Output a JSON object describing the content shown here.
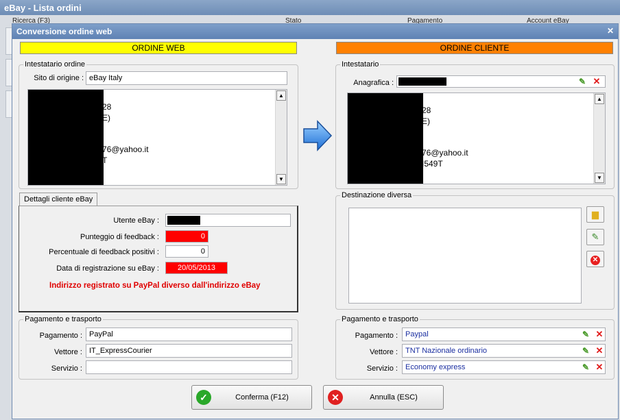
{
  "background": {
    "title": "eBay - Lista ordini",
    "headers": [
      "Ricerca (F3)",
      "Stato",
      "Pagamento",
      "Account eBay"
    ]
  },
  "dialog": {
    "title": "Conversione ordine web",
    "close_icon": "close-icon"
  },
  "left": {
    "banner": "ORDINE WEB",
    "banner_color": "#ffff00",
    "intestatario": {
      "group_label": "Intestatario ordine",
      "sito_label": "Sito di origine :",
      "sito_value": "eBay Italy",
      "address_lines": [
        "28",
        "E)",
        "",
        "",
        "76@yahoo.it",
        "T"
      ]
    },
    "tab_label": "Dettagli cliente eBay",
    "details": {
      "utente_label": "Utente eBay :",
      "feedback_label": "Punteggio di feedback :",
      "feedback_value": "0",
      "perc_label": "Percentuale di feedback positivi :",
      "perc_value": "0",
      "data_label": "Data di registrazione su eBay :",
      "data_value": "20/05/2013",
      "warning": "Indirizzo registrato su PayPal diverso dall'indirizzo eBay"
    },
    "pagamento": {
      "group_label": "Pagamento e trasporto",
      "pagamento_label": "Pagamento :",
      "pagamento_value": "PayPal",
      "vettore_label": "Vettore :",
      "vettore_value": "IT_ExpressCourier",
      "servizio_label": "Servizio :",
      "servizio_value": ""
    }
  },
  "right": {
    "banner": "ORDINE CLIENTE",
    "banner_color": "#ff8000",
    "intestatario": {
      "group_label": "Intestatario",
      "anagrafica_label": "Anagrafica :",
      "address_lines": [
        "28",
        "E)",
        "",
        "",
        "76@yahoo.it",
        "I549T"
      ]
    },
    "destinazione": {
      "group_label": "Destinazione diversa"
    },
    "pagamento": {
      "group_label": "Pagamento e trasporto",
      "pagamento_label": "Pagamento :",
      "pagamento_value": "Paypal",
      "vettore_label": "Vettore :",
      "vettore_value": "TNT Nazionale ordinario",
      "servizio_label": "Servizio :",
      "servizio_value": "Economy express"
    }
  },
  "buttons": {
    "confirm_label": "Conferma (F12)",
    "cancel_label": "Annulla (ESC)"
  }
}
